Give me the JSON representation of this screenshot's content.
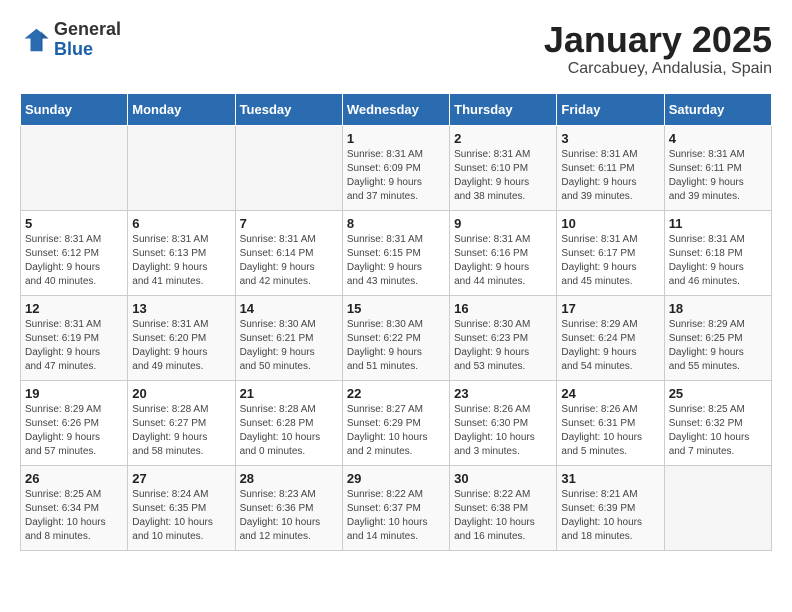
{
  "logo": {
    "general": "General",
    "blue": "Blue"
  },
  "title": {
    "month_year": "January 2025",
    "location": "Carcabuey, Andalusia, Spain"
  },
  "weekdays": [
    "Sunday",
    "Monday",
    "Tuesday",
    "Wednesday",
    "Thursday",
    "Friday",
    "Saturday"
  ],
  "weeks": [
    [
      {
        "day": "",
        "info": ""
      },
      {
        "day": "",
        "info": ""
      },
      {
        "day": "",
        "info": ""
      },
      {
        "day": "1",
        "info": "Sunrise: 8:31 AM\nSunset: 6:09 PM\nDaylight: 9 hours\nand 37 minutes."
      },
      {
        "day": "2",
        "info": "Sunrise: 8:31 AM\nSunset: 6:10 PM\nDaylight: 9 hours\nand 38 minutes."
      },
      {
        "day": "3",
        "info": "Sunrise: 8:31 AM\nSunset: 6:11 PM\nDaylight: 9 hours\nand 39 minutes."
      },
      {
        "day": "4",
        "info": "Sunrise: 8:31 AM\nSunset: 6:11 PM\nDaylight: 9 hours\nand 39 minutes."
      }
    ],
    [
      {
        "day": "5",
        "info": "Sunrise: 8:31 AM\nSunset: 6:12 PM\nDaylight: 9 hours\nand 40 minutes."
      },
      {
        "day": "6",
        "info": "Sunrise: 8:31 AM\nSunset: 6:13 PM\nDaylight: 9 hours\nand 41 minutes."
      },
      {
        "day": "7",
        "info": "Sunrise: 8:31 AM\nSunset: 6:14 PM\nDaylight: 9 hours\nand 42 minutes."
      },
      {
        "day": "8",
        "info": "Sunrise: 8:31 AM\nSunset: 6:15 PM\nDaylight: 9 hours\nand 43 minutes."
      },
      {
        "day": "9",
        "info": "Sunrise: 8:31 AM\nSunset: 6:16 PM\nDaylight: 9 hours\nand 44 minutes."
      },
      {
        "day": "10",
        "info": "Sunrise: 8:31 AM\nSunset: 6:17 PM\nDaylight: 9 hours\nand 45 minutes."
      },
      {
        "day": "11",
        "info": "Sunrise: 8:31 AM\nSunset: 6:18 PM\nDaylight: 9 hours\nand 46 minutes."
      }
    ],
    [
      {
        "day": "12",
        "info": "Sunrise: 8:31 AM\nSunset: 6:19 PM\nDaylight: 9 hours\nand 47 minutes."
      },
      {
        "day": "13",
        "info": "Sunrise: 8:31 AM\nSunset: 6:20 PM\nDaylight: 9 hours\nand 49 minutes."
      },
      {
        "day": "14",
        "info": "Sunrise: 8:30 AM\nSunset: 6:21 PM\nDaylight: 9 hours\nand 50 minutes."
      },
      {
        "day": "15",
        "info": "Sunrise: 8:30 AM\nSunset: 6:22 PM\nDaylight: 9 hours\nand 51 minutes."
      },
      {
        "day": "16",
        "info": "Sunrise: 8:30 AM\nSunset: 6:23 PM\nDaylight: 9 hours\nand 53 minutes."
      },
      {
        "day": "17",
        "info": "Sunrise: 8:29 AM\nSunset: 6:24 PM\nDaylight: 9 hours\nand 54 minutes."
      },
      {
        "day": "18",
        "info": "Sunrise: 8:29 AM\nSunset: 6:25 PM\nDaylight: 9 hours\nand 55 minutes."
      }
    ],
    [
      {
        "day": "19",
        "info": "Sunrise: 8:29 AM\nSunset: 6:26 PM\nDaylight: 9 hours\nand 57 minutes."
      },
      {
        "day": "20",
        "info": "Sunrise: 8:28 AM\nSunset: 6:27 PM\nDaylight: 9 hours\nand 58 minutes."
      },
      {
        "day": "21",
        "info": "Sunrise: 8:28 AM\nSunset: 6:28 PM\nDaylight: 10 hours\nand 0 minutes."
      },
      {
        "day": "22",
        "info": "Sunrise: 8:27 AM\nSunset: 6:29 PM\nDaylight: 10 hours\nand 2 minutes."
      },
      {
        "day": "23",
        "info": "Sunrise: 8:26 AM\nSunset: 6:30 PM\nDaylight: 10 hours\nand 3 minutes."
      },
      {
        "day": "24",
        "info": "Sunrise: 8:26 AM\nSunset: 6:31 PM\nDaylight: 10 hours\nand 5 minutes."
      },
      {
        "day": "25",
        "info": "Sunrise: 8:25 AM\nSunset: 6:32 PM\nDaylight: 10 hours\nand 7 minutes."
      }
    ],
    [
      {
        "day": "26",
        "info": "Sunrise: 8:25 AM\nSunset: 6:34 PM\nDaylight: 10 hours\nand 8 minutes."
      },
      {
        "day": "27",
        "info": "Sunrise: 8:24 AM\nSunset: 6:35 PM\nDaylight: 10 hours\nand 10 minutes."
      },
      {
        "day": "28",
        "info": "Sunrise: 8:23 AM\nSunset: 6:36 PM\nDaylight: 10 hours\nand 12 minutes."
      },
      {
        "day": "29",
        "info": "Sunrise: 8:22 AM\nSunset: 6:37 PM\nDaylight: 10 hours\nand 14 minutes."
      },
      {
        "day": "30",
        "info": "Sunrise: 8:22 AM\nSunset: 6:38 PM\nDaylight: 10 hours\nand 16 minutes."
      },
      {
        "day": "31",
        "info": "Sunrise: 8:21 AM\nSunset: 6:39 PM\nDaylight: 10 hours\nand 18 minutes."
      },
      {
        "day": "",
        "info": ""
      }
    ]
  ]
}
